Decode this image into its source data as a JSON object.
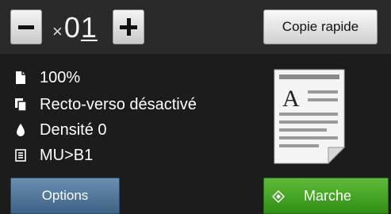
{
  "copies": {
    "multiplier": "×",
    "value_first": "0",
    "value_cursor": "1"
  },
  "buttons": {
    "decrease": "minus",
    "increase": "plus",
    "quick_copy": "Copie rapide",
    "options": "Options",
    "start": "Marche"
  },
  "settings": [
    {
      "icon": "enlarge-reduce-icon",
      "label": "100%"
    },
    {
      "icon": "duplex-icon",
      "label": "Recto-verso désactivé"
    },
    {
      "icon": "density-drop-icon",
      "label": "Densité 0"
    },
    {
      "icon": "tray-icon",
      "label": "MU>B1"
    }
  ],
  "preview": {
    "sample_letter": "A"
  },
  "colors": {
    "start_green": "#3fa01d",
    "options_blue": "#4f7599",
    "background": "#1c1c1c"
  }
}
